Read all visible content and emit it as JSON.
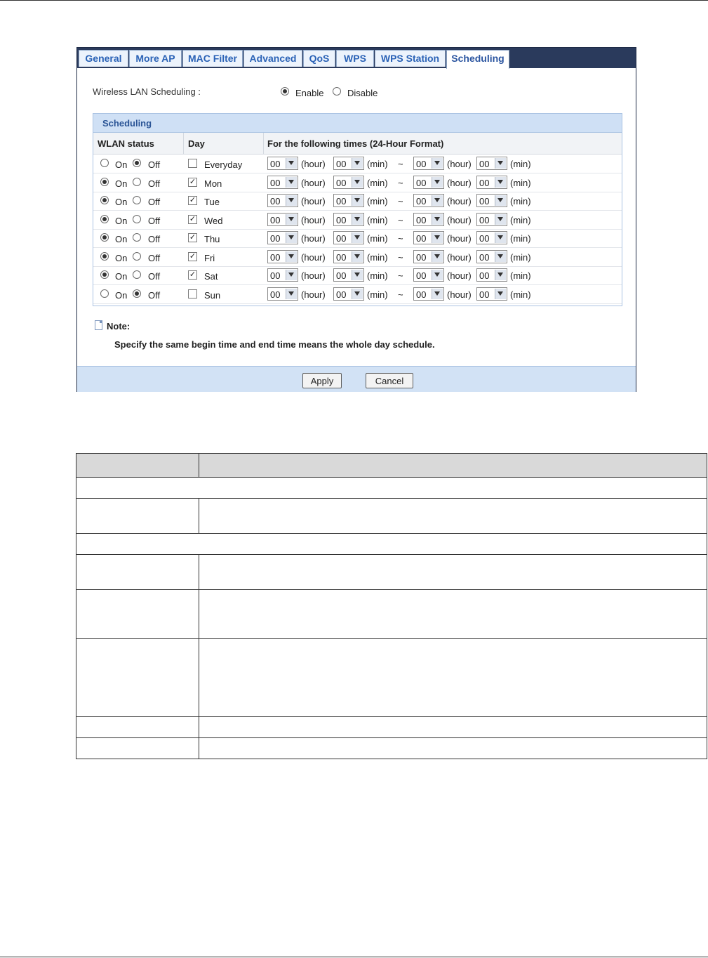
{
  "tabs": [
    "General",
    "More AP",
    "MAC Filter",
    "Advanced",
    "QoS",
    "WPS",
    "WPS Station",
    "Scheduling"
  ],
  "active_tab": "Scheduling",
  "wireless": {
    "label": "Wireless LAN Scheduling :",
    "enable_label": "Enable",
    "disable_label": "Disable",
    "selected": "Enable"
  },
  "scheduling": {
    "title": "Scheduling",
    "col_status": "WLAN status",
    "col_day": "Day",
    "col_times": "For the following times (24-Hour Format)",
    "on_label": "On",
    "off_label": "Off",
    "hour_unit": "(hour)",
    "min_unit": "(min)",
    "tilde": "~",
    "rows": [
      {
        "day": "Everyday",
        "status": "Off",
        "checked": false,
        "start_hour": "00",
        "start_min": "00",
        "end_hour": "00",
        "end_min": "00"
      },
      {
        "day": "Mon",
        "status": "On",
        "checked": true,
        "start_hour": "00",
        "start_min": "00",
        "end_hour": "00",
        "end_min": "00"
      },
      {
        "day": "Tue",
        "status": "On",
        "checked": true,
        "start_hour": "00",
        "start_min": "00",
        "end_hour": "00",
        "end_min": "00"
      },
      {
        "day": "Wed",
        "status": "On",
        "checked": true,
        "start_hour": "00",
        "start_min": "00",
        "end_hour": "00",
        "end_min": "00"
      },
      {
        "day": "Thu",
        "status": "On",
        "checked": true,
        "start_hour": "00",
        "start_min": "00",
        "end_hour": "00",
        "end_min": "00"
      },
      {
        "day": "Fri",
        "status": "On",
        "checked": true,
        "start_hour": "00",
        "start_min": "00",
        "end_hour": "00",
        "end_min": "00"
      },
      {
        "day": "Sat",
        "status": "On",
        "checked": true,
        "start_hour": "00",
        "start_min": "00",
        "end_hour": "00",
        "end_min": "00"
      },
      {
        "day": "Sun",
        "status": "Off",
        "checked": false,
        "start_hour": "00",
        "start_min": "00",
        "end_hour": "00",
        "end_min": "00"
      }
    ]
  },
  "note": {
    "label": "Note:",
    "text": "Specify the same begin time and end time means the whole day schedule."
  },
  "buttons": {
    "apply": "Apply",
    "cancel": "Cancel"
  },
  "colors": {
    "tabbar": "#2a3a5c",
    "tab_text": "#2a62b6",
    "section_header": "#cfe0f5",
    "footer": "#d2e2f5"
  }
}
